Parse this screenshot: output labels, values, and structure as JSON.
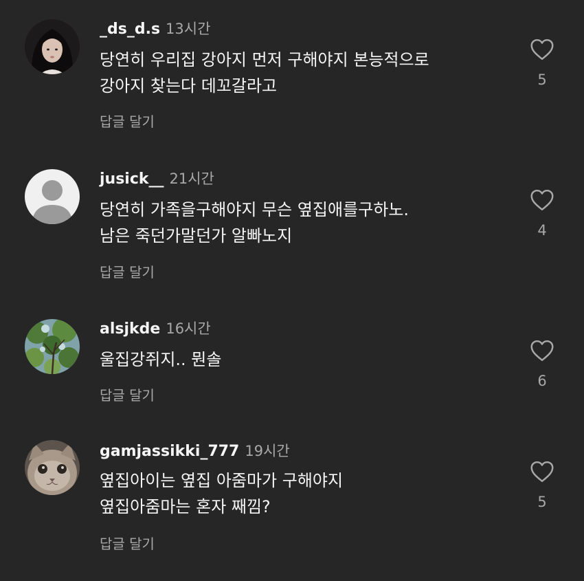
{
  "comments": [
    {
      "username": "_ds_d.s",
      "time": "13시간",
      "text": "당연히 우리집 강아지 먼저 구해야지 본능적으로\n강아지 찾는다 데꼬갈라고",
      "reply_label": "답글 달기",
      "likes": "5",
      "avatar_icon": "user-photo-avatar"
    },
    {
      "username": "jusick__",
      "time": "21시간",
      "text": "당연히 가족을구해야지 무슨 옆집애를구하노.\n남은 죽던가말던가 알빠노지",
      "reply_label": "답글 달기",
      "likes": "4",
      "avatar_icon": "default-user-icon"
    },
    {
      "username": "alsjkde",
      "time": "16시간",
      "text": "울집강쥐지.. 뭔솔",
      "reply_label": "답글 달기",
      "likes": "6",
      "avatar_icon": "tree-photo-avatar"
    },
    {
      "username": "gamjassikki_777",
      "time": "19시간",
      "text": "옆집아이는 옆집 아줌마가 구해야지\n옆집아줌마는 혼자 째낌?",
      "reply_label": "답글 달기",
      "likes": "5",
      "avatar_icon": "cat-photo-avatar"
    }
  ],
  "colors": {
    "background": "#262626",
    "primary_text": "#f5f5f5",
    "secondary_text": "#a8a8a8"
  }
}
